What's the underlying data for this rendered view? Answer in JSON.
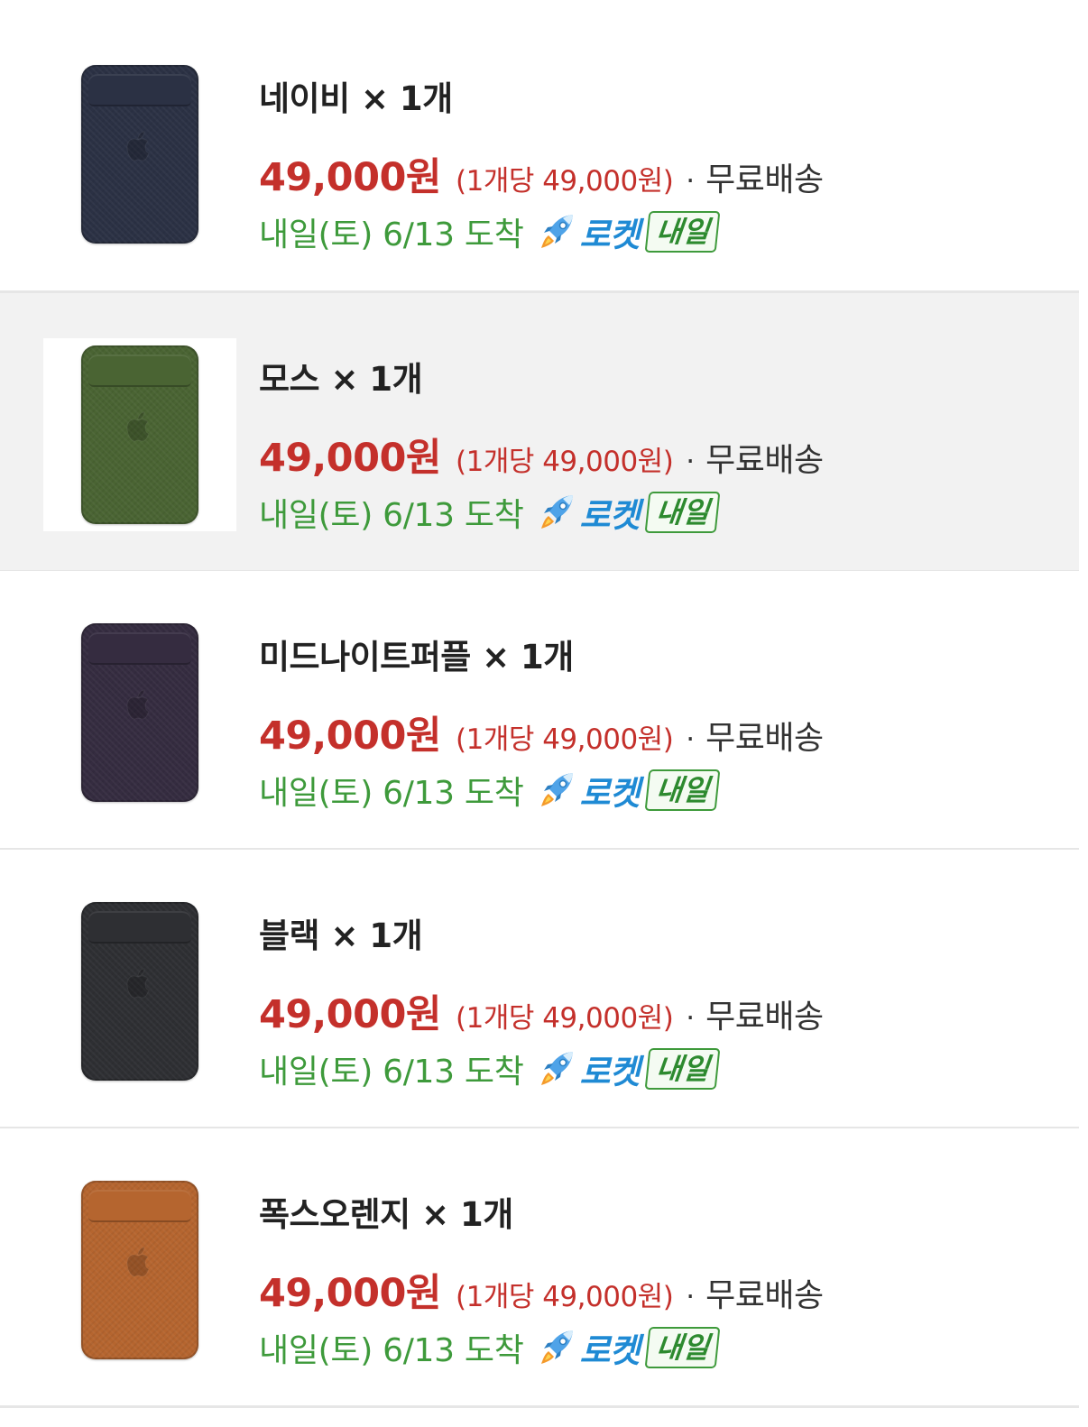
{
  "items": [
    {
      "option": "네이비 × 1개",
      "price": "49,000원",
      "unit_price": "(1개당 49,000원)",
      "shipping": "무료배송",
      "arrival": "내일(토) 6/13 도착",
      "rocket_label": "로켓",
      "tomorrow_badge": "내일",
      "color": "#2b3144",
      "selected": false
    },
    {
      "option": "모스 × 1개",
      "price": "49,000원",
      "unit_price": "(1개당 49,000원)",
      "shipping": "무료배송",
      "arrival": "내일(토) 6/13 도착",
      "rocket_label": "로켓",
      "tomorrow_badge": "내일",
      "color": "#4a6433",
      "selected": true
    },
    {
      "option": "미드나이트퍼플 × 1개",
      "price": "49,000원",
      "unit_price": "(1개당 49,000원)",
      "shipping": "무료배송",
      "arrival": "내일(토) 6/13 도착",
      "rocket_label": "로켓",
      "tomorrow_badge": "내일",
      "color": "#352c40",
      "selected": false
    },
    {
      "option": "블랙 × 1개",
      "price": "49,000원",
      "unit_price": "(1개당 49,000원)",
      "shipping": "무료배송",
      "arrival": "내일(토) 6/13 도착",
      "rocket_label": "로켓",
      "tomorrow_badge": "내일",
      "color": "#2e2f33",
      "selected": false
    },
    {
      "option": "폭스오렌지 × 1개",
      "price": "49,000원",
      "unit_price": "(1개당 49,000원)",
      "shipping": "무료배송",
      "arrival": "내일(토) 6/13 도착",
      "rocket_label": "로켓",
      "tomorrow_badge": "내일",
      "color": "#b5652f",
      "selected": false
    }
  ],
  "icons": {
    "wallet_logo": "apple-logo-icon",
    "rocket": "rocket-icon"
  },
  "colors": {
    "price": "#c4302b",
    "arrival": "#3e9a3b",
    "rocket_label": "#1f8ad4",
    "selected_row_bg": "#f2f2f2"
  }
}
